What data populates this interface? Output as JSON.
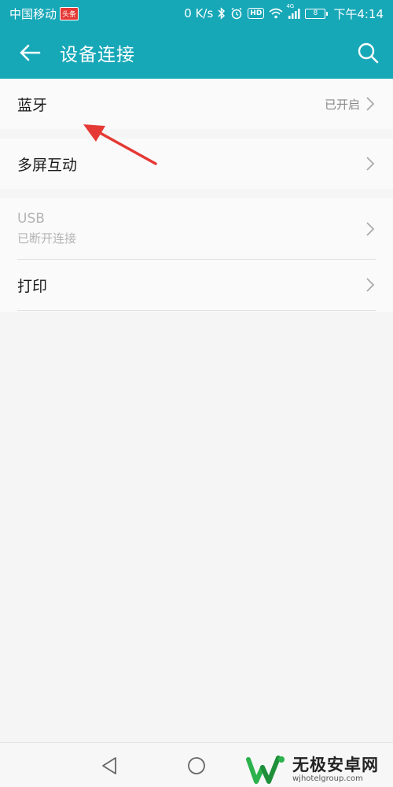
{
  "status_bar": {
    "carrier": "中国移动",
    "news_badge": "头条",
    "speed": "0 K/s",
    "network": "4G",
    "battery": "8",
    "time": "下午4:14"
  },
  "app_bar": {
    "title": "设备连接"
  },
  "settings": {
    "bluetooth": {
      "label": "蓝牙",
      "status": "已开启"
    },
    "multiscreen": {
      "label": "多屏互动"
    },
    "usb": {
      "label": "USB",
      "status": "已断开连接"
    },
    "print": {
      "label": "打印"
    }
  },
  "watermark": {
    "name": "无极安卓网",
    "url": "wjhotelgroup.com"
  },
  "colors": {
    "accent": "#17a8b8",
    "annotation_arrow": "#e53935"
  }
}
